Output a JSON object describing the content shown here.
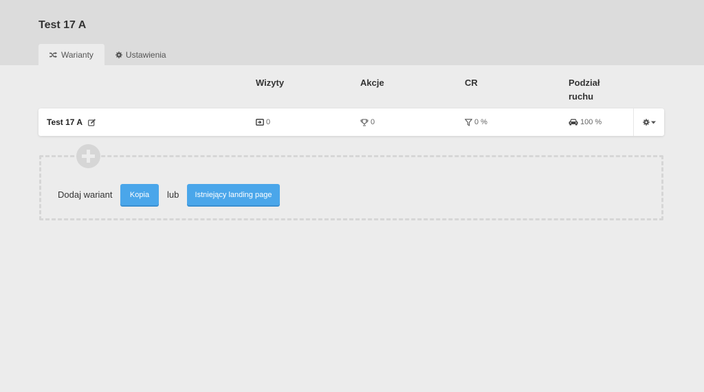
{
  "page": {
    "title": "Test 17 A"
  },
  "tabs": [
    {
      "label": "Warianty",
      "icon": "shuffle-icon",
      "active": true
    },
    {
      "label": "Ustawienia",
      "icon": "gear-icon",
      "active": false
    }
  ],
  "table": {
    "columns": [
      "Wizyty",
      "Akcje",
      "CR",
      "Podział",
      "ruchu"
    ],
    "rows": [
      {
        "name": "Test 17 A",
        "visits": "0",
        "actions": "0",
        "cr": "0 %",
        "traffic": "100 %"
      }
    ]
  },
  "add_variant": {
    "label": "Dodaj wariant",
    "copy_button": "Kopia",
    "or_label": "lub",
    "existing_button": "Istniejący landing page"
  },
  "colors": {
    "header_bg": "#dcdcdc",
    "page_bg": "#ececec",
    "button_blue": "#4aa6ea"
  }
}
